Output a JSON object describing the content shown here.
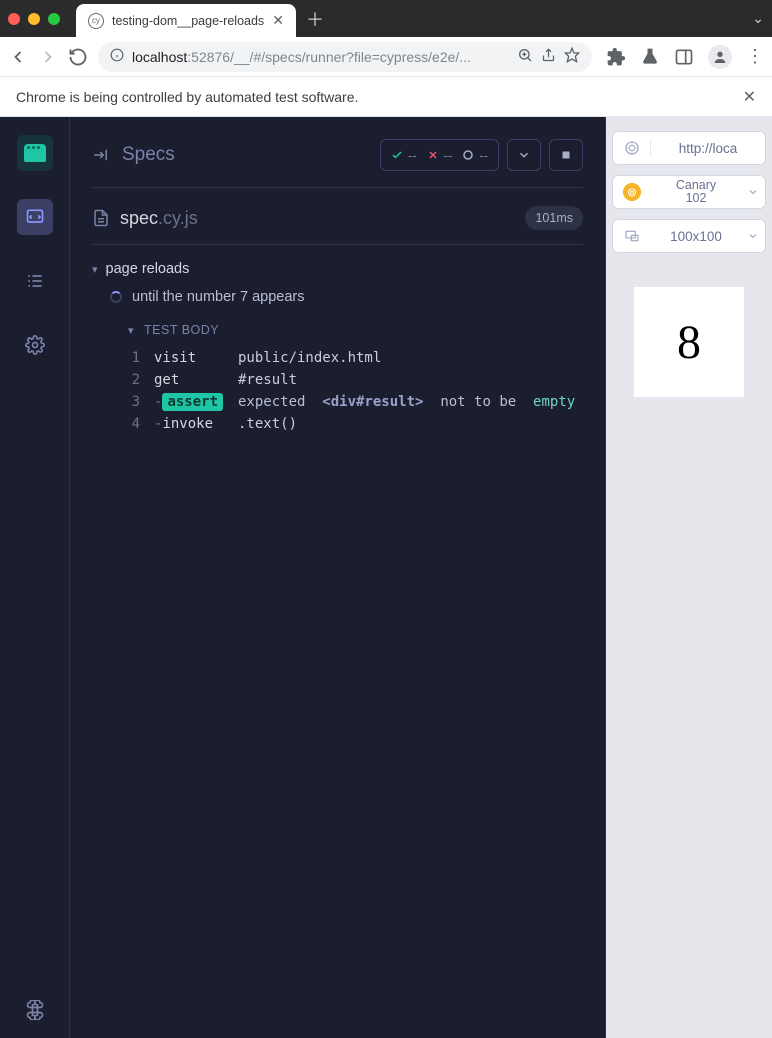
{
  "browser": {
    "tab_title": "testing-dom__page-reloads",
    "url_host": "localhost",
    "url_port": ":52876",
    "url_path": "/__/#/specs/runner?file=cypress/e2e/...",
    "info_bar": "Chrome is being controlled by automated test software."
  },
  "reporter": {
    "title": "Specs",
    "stats": {
      "pass": "--",
      "fail": "--",
      "pending": "--"
    },
    "spec_name": "spec",
    "spec_ext": ".cy.js",
    "duration": "101ms",
    "describe": "page reloads",
    "it": "until the number 7 appears",
    "test_body_label": "TEST BODY",
    "commands": [
      {
        "num": "1",
        "name": "visit",
        "msg_plain": "public/index.html"
      },
      {
        "num": "2",
        "name": "get",
        "msg_plain": "#result"
      },
      {
        "num": "3",
        "name_prefix": "-",
        "name_badge": "assert",
        "msg_assert": {
          "expected": "expected",
          "sel": "<div#result>",
          "neg": "not to be",
          "emp": "empty"
        }
      },
      {
        "num": "4",
        "name_prefix": "-",
        "name": "invoke",
        "msg_plain": ".text()"
      }
    ]
  },
  "aut": {
    "url": "http://loca",
    "browser_name": "Canary",
    "browser_version": "102",
    "viewport": "100x100",
    "result": "8"
  }
}
